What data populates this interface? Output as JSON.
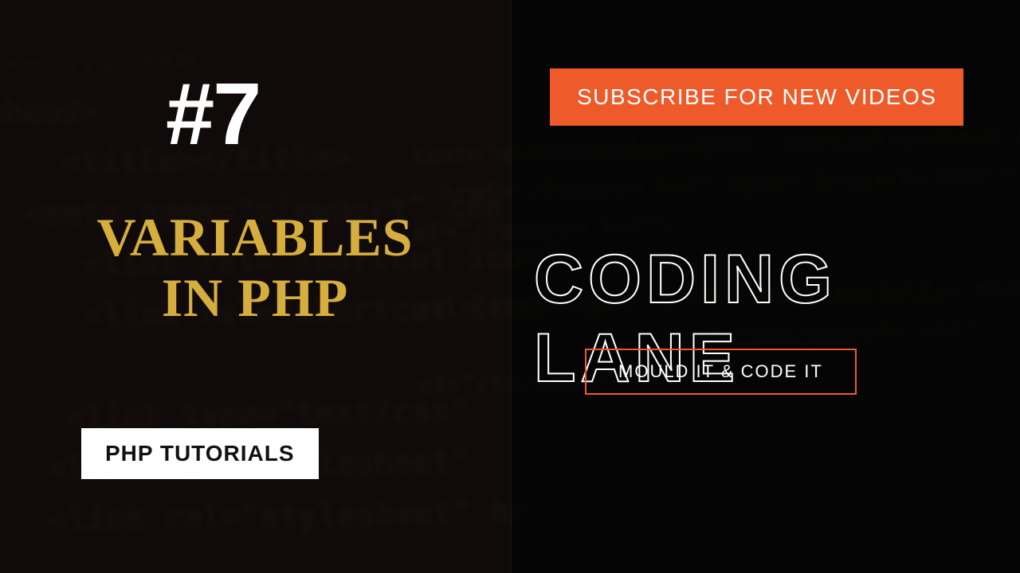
{
  "left": {
    "episode": "#7",
    "title_line1": "VARIABLES",
    "title_line2": "IN PHP",
    "badge": "PHP TUTORIALS"
  },
  "right": {
    "subscribe": "SUBSCRIBE FOR NEW VIDEOS",
    "brand": "CODING LANE",
    "tagline": "MOULD IT & CODE IT"
  },
  "colors": {
    "accent": "#ef5a2a",
    "gold": "#d6ae3d",
    "white": "#ffffff",
    "black": "#0a0a0a"
  }
}
